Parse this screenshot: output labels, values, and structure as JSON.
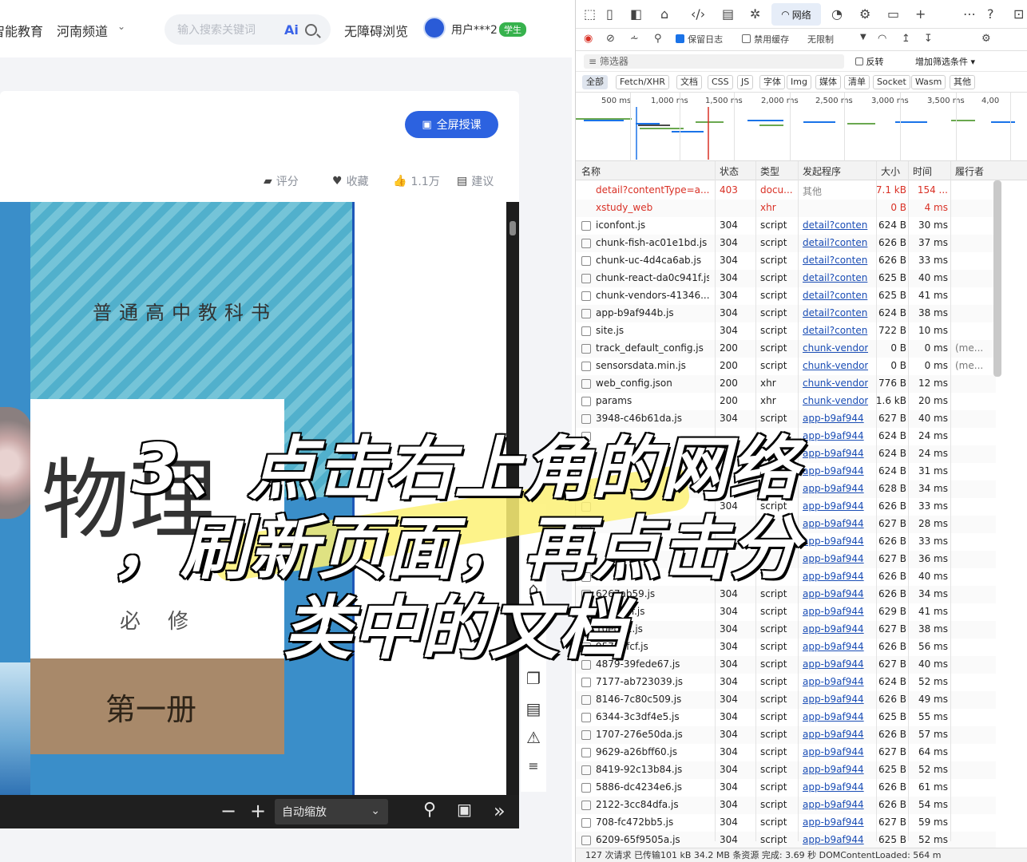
{
  "header": {
    "nav": [
      "智能教育",
      "河南频道"
    ],
    "search_placeholder": "输入搜索关键词",
    "ai_label": "Ai",
    "accessibility": "无障碍浏览",
    "user_name": "用户***2",
    "user_badge": "学生"
  },
  "content": {
    "fullscreen_button": "全屏授课",
    "actions": {
      "rate": "评分",
      "favorite": "收藏",
      "like": "1.1万",
      "suggest": "建议"
    }
  },
  "book": {
    "series": "普通高中教科书",
    "subject": "物理",
    "required": "必修",
    "volume": "第一册"
  },
  "pdf_toolbar": {
    "zoom": "自动缩放"
  },
  "devtools": {
    "tabs": {
      "network": "网络"
    },
    "toolbar": {
      "preserve_log": "保留日志",
      "disable_cache": "禁用缓存",
      "throttle": "无限制"
    },
    "filter": {
      "placeholder": "筛选器",
      "invert": "反转",
      "more_filters": "增加筛选条件"
    },
    "types": [
      "全部",
      "Fetch/XHR",
      "文档",
      "CSS",
      "JS",
      "字体",
      "Img",
      "媒体",
      "清单",
      "Socket",
      "Wasm",
      "其他"
    ],
    "timeline_ticks": [
      "500 ms",
      "1,000 ms",
      "1,500 ms",
      "2,000 ms",
      "2,500 ms",
      "3,000 ms",
      "3,500 ms",
      "4,00"
    ],
    "columns": [
      "名称",
      "状态",
      "类型",
      "发起程序",
      "大小",
      "时间",
      "履行者"
    ],
    "rows": [
      {
        "name": "detail?contentType=a...",
        "status": "403",
        "type": "docu...",
        "init": "其他",
        "size": "7.1 kB",
        "time": "154 ...",
        "actor": "",
        "err": true
      },
      {
        "name": "xstudy_web",
        "status": "",
        "type": "xhr",
        "init": "",
        "size": "0 B",
        "time": "4 ms",
        "actor": "",
        "err": true
      },
      {
        "name": "iconfont.js",
        "status": "304",
        "type": "script",
        "init": "detail?conten",
        "size": "624 B",
        "time": "30 ms",
        "actor": ""
      },
      {
        "name": "chunk-fish-ac01e1bd.js",
        "status": "304",
        "type": "script",
        "init": "detail?conten",
        "size": "626 B",
        "time": "37 ms",
        "actor": ""
      },
      {
        "name": "chunk-uc-4d4ca6ab.js",
        "status": "304",
        "type": "script",
        "init": "detail?conten",
        "size": "626 B",
        "time": "33 ms",
        "actor": ""
      },
      {
        "name": "chunk-react-da0c941f.js",
        "status": "304",
        "type": "script",
        "init": "detail?conten",
        "size": "625 B",
        "time": "40 ms",
        "actor": ""
      },
      {
        "name": "chunk-vendors-41346...",
        "status": "304",
        "type": "script",
        "init": "detail?conten",
        "size": "625 B",
        "time": "41 ms",
        "actor": ""
      },
      {
        "name": "app-b9af944b.js",
        "status": "304",
        "type": "script",
        "init": "detail?conten",
        "size": "624 B",
        "time": "38 ms",
        "actor": ""
      },
      {
        "name": "site.js",
        "status": "304",
        "type": "script",
        "init": "detail?conten",
        "size": "722 B",
        "time": "10 ms",
        "actor": ""
      },
      {
        "name": "track_default_config.js",
        "status": "200",
        "type": "script",
        "init": "chunk-vendor",
        "size": "0 B",
        "time": "0 ms",
        "actor": "(me..."
      },
      {
        "name": "sensorsdata.min.js",
        "status": "200",
        "type": "script",
        "init": "chunk-vendor",
        "size": "0 B",
        "time": "0 ms",
        "actor": "(me..."
      },
      {
        "name": "web_config.json",
        "status": "200",
        "type": "xhr",
        "init": "chunk-vendor",
        "size": "776 B",
        "time": "12 ms",
        "actor": ""
      },
      {
        "name": "params",
        "status": "200",
        "type": "xhr",
        "init": "chunk-vendor",
        "size": "1.6 kB",
        "time": "20 ms",
        "actor": ""
      },
      {
        "name": "3948-c46b61da.js",
        "status": "304",
        "type": "script",
        "init": "app-b9af944",
        "size": "627 B",
        "time": "40 ms",
        "actor": ""
      },
      {
        "name": "",
        "status": "",
        "type": "",
        "init": "app-b9af944",
        "size": "624 B",
        "time": "24 ms",
        "actor": ""
      },
      {
        "name": "",
        "status": "",
        "type": "",
        "init": "app-b9af944",
        "size": "624 B",
        "time": "24 ms",
        "actor": ""
      },
      {
        "name": "",
        "status": "",
        "type": "",
        "init": "app-b9af944",
        "size": "624 B",
        "time": "31 ms",
        "actor": ""
      },
      {
        "name": "",
        "status": "",
        "type": "",
        "init": "app-b9af944",
        "size": "628 B",
        "time": "34 ms",
        "actor": ""
      },
      {
        "name": "",
        "status": "304",
        "type": "script",
        "init": "app-b9af944",
        "size": "626 B",
        "time": "33 ms",
        "actor": ""
      },
      {
        "name": "",
        "status": "",
        "type": "",
        "init": "app-b9af944",
        "size": "627 B",
        "time": "28 ms",
        "actor": ""
      },
      {
        "name": "",
        "status": "",
        "type": "",
        "init": "app-b9af944",
        "size": "626 B",
        "time": "33 ms",
        "actor": ""
      },
      {
        "name": "",
        "status": "",
        "type": "",
        "init": "app-b9af944",
        "size": "627 B",
        "time": "36 ms",
        "actor": ""
      },
      {
        "name": "",
        "status": "",
        "type": "",
        "init": "app-b9af944",
        "size": "626 B",
        "time": "40 ms",
        "actor": ""
      },
      {
        "name": "6267ab59.js",
        "status": "304",
        "type": "script",
        "init": "app-b9af944",
        "size": "626 B",
        "time": "34 ms",
        "actor": ""
      },
      {
        "name": "c7d550f.js",
        "status": "304",
        "type": "script",
        "init": "app-b9af944",
        "size": "629 B",
        "time": "41 ms",
        "actor": ""
      },
      {
        "name": "10edd1.js",
        "status": "304",
        "type": "script",
        "init": "app-b9af944",
        "size": "627 B",
        "time": "38 ms",
        "actor": ""
      },
      {
        "name": "95711fcf.js",
        "status": "304",
        "type": "script",
        "init": "app-b9af944",
        "size": "626 B",
        "time": "56 ms",
        "actor": ""
      },
      {
        "name": "4879-39fede67.js",
        "status": "304",
        "type": "script",
        "init": "app-b9af944",
        "size": "627 B",
        "time": "40 ms",
        "actor": ""
      },
      {
        "name": "7177-ab723039.js",
        "status": "304",
        "type": "script",
        "init": "app-b9af944",
        "size": "624 B",
        "time": "52 ms",
        "actor": ""
      },
      {
        "name": "8146-7c80c509.js",
        "status": "304",
        "type": "script",
        "init": "app-b9af944",
        "size": "626 B",
        "time": "49 ms",
        "actor": ""
      },
      {
        "name": "6344-3c3df4e5.js",
        "status": "304",
        "type": "script",
        "init": "app-b9af944",
        "size": "625 B",
        "time": "55 ms",
        "actor": ""
      },
      {
        "name": "1707-276e50da.js",
        "status": "304",
        "type": "script",
        "init": "app-b9af944",
        "size": "626 B",
        "time": "57 ms",
        "actor": ""
      },
      {
        "name": "9629-a26bff60.js",
        "status": "304",
        "type": "script",
        "init": "app-b9af944",
        "size": "627 B",
        "time": "64 ms",
        "actor": ""
      },
      {
        "name": "8419-92c13b84.js",
        "status": "304",
        "type": "script",
        "init": "app-b9af944",
        "size": "625 B",
        "time": "52 ms",
        "actor": ""
      },
      {
        "name": "5886-dc4234e6.js",
        "status": "304",
        "type": "script",
        "init": "app-b9af944",
        "size": "626 B",
        "time": "61 ms",
        "actor": ""
      },
      {
        "name": "2122-3cc84dfa.js",
        "status": "304",
        "type": "script",
        "init": "app-b9af944",
        "size": "626 B",
        "time": "54 ms",
        "actor": ""
      },
      {
        "name": "708-fc472bb5.js",
        "status": "304",
        "type": "script",
        "init": "app-b9af944",
        "size": "627 B",
        "time": "59 ms",
        "actor": ""
      },
      {
        "name": "6209-65f9505a.js",
        "status": "304",
        "type": "script",
        "init": "app-b9af944",
        "size": "625 B",
        "time": "52 ms",
        "actor": ""
      }
    ],
    "status_bar": "127 次请求  已传输101 kB  34.2 MB 条资源  完成: 3.69 秒  DOMContentLoaded: 564 m"
  },
  "overlay": {
    "line1": "3、点击右上角的网络",
    "line2": "，刷新页面，再点击分",
    "line3": "类中的文档"
  }
}
